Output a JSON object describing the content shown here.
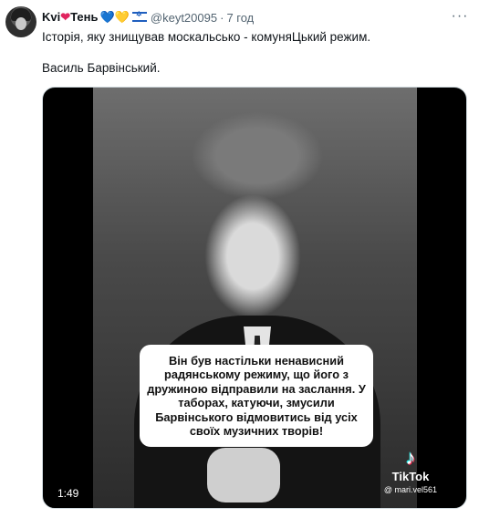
{
  "tweet": {
    "author_name": "Kvi",
    "author_suffix": "Тень",
    "heart_emoji": "❤",
    "hearts": "💙💛",
    "handle": "@keyt20095",
    "separator": "·",
    "time": "7 год",
    "more_icon": "···",
    "text_line1": "Історія, яку знищував москальсько - комуняЦький режим.",
    "text_line2": "Василь Барвінський."
  },
  "media": {
    "caption": "Він був настільки ненависний радянському режиму, що його з дружиною відправили на заслання. У таборах, катуючи, змусили Барвінського відмовитись від усіх своїх музичних творів!",
    "duration": "1:49",
    "watermark_icon": "♪",
    "watermark_label": "TikTok",
    "watermark_user": "@ mari.vel561"
  },
  "colors": {
    "text": "#0f1419",
    "secondary": "#536471",
    "heart": "#e0245e",
    "blue_heart": "#5da9e9",
    "yellow_heart": "#ffcc4d"
  }
}
